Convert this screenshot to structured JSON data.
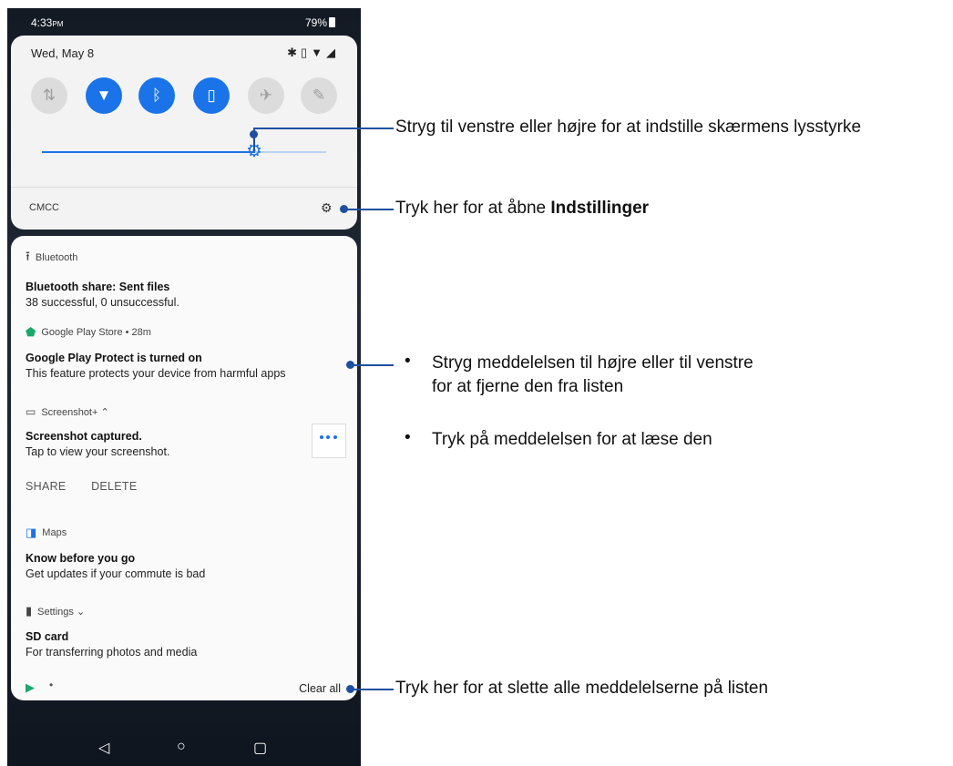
{
  "status_bar": {
    "time": "4:33",
    "time_suffix": "PM",
    "battery": "79%"
  },
  "quick_settings": {
    "date": "Wed, May 8",
    "tiles": [
      {
        "name": "data",
        "glyph": "⇅",
        "state": "off"
      },
      {
        "name": "wifi",
        "glyph": "▼",
        "state": "on"
      },
      {
        "name": "bluetooth",
        "glyph": "ᛒ",
        "state": "on"
      },
      {
        "name": "vibrate",
        "glyph": "▯",
        "state": "on"
      },
      {
        "name": "airplane",
        "glyph": "✈",
        "state": "off"
      },
      {
        "name": "game",
        "glyph": "✎",
        "state": "off"
      }
    ],
    "brightness_level": 0.75,
    "carrier": "CMCC"
  },
  "notifications": [
    {
      "app": "Bluetooth",
      "title": "Bluetooth share: Sent files",
      "text": "38 successful, 0 unsuccessful."
    },
    {
      "app": "Google Play Store • 28m",
      "title": "Google Play Protect is turned on",
      "text": "This feature protects your device from harmful apps"
    },
    {
      "app": "Screenshot+ ⌃",
      "title": "Screenshot captured.",
      "text": "Tap to view your screenshot.",
      "actions": [
        "SHARE",
        "DELETE"
      ]
    },
    {
      "app": "Maps",
      "title": "Know before you go",
      "text": "Get updates if your commute is bad"
    },
    {
      "app": "Settings ⌄",
      "title": "SD card",
      "text": "For transferring photos and media"
    }
  ],
  "clear_all": "Clear all",
  "callouts": {
    "brightness": "Stryg til venstre eller højre for at indstille skærmens lysstyrke",
    "settings_prefix": "Tryk her for at åbne ",
    "settings_bold": "Indstillinger",
    "swipe_line1": "Stryg meddelelsen til højre eller til venstre",
    "swipe_line2": "for at fjerne den fra listen",
    "tap": "Tryk på meddelelsen for at læse den",
    "clear": "Tryk her for at slette alle meddelelserne på listen"
  },
  "colors": {
    "accent": "#1a73e8",
    "callout_line": "#1e4fa0"
  }
}
